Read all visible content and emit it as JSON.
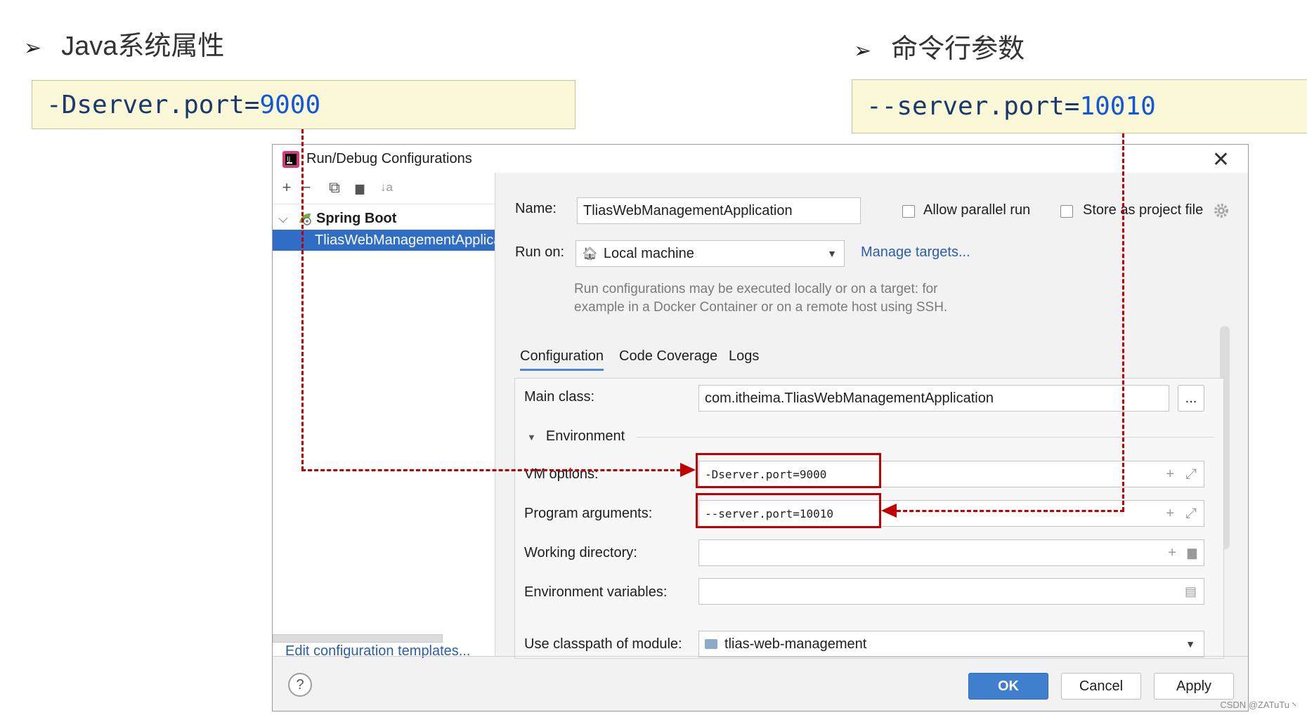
{
  "slide": {
    "left_heading": "Java系统属性",
    "right_heading": "命令行参数",
    "bullet": "➢",
    "left_code_prefix": "-Dserver.port=",
    "left_code_value": "9000",
    "right_code_prefix": "--server.port=",
    "right_code_value": "10010",
    "watermark": "CSDN @ZATuTu丶"
  },
  "dialog": {
    "title": "Run/Debug Configurations",
    "close_symbol": "✕",
    "toolbar": {
      "add": "+",
      "remove": "−",
      "copy": "⧉",
      "folder": "▆",
      "sort": "↓a"
    },
    "tree": {
      "group_arrow": "⌵",
      "group": "Spring Boot",
      "item": "TliasWebManagementApplication"
    },
    "edit_templates": "Edit configuration templates...",
    "name_label": "Name:",
    "name_value": "TliasWebManagementApplication",
    "allow_parallel": "Allow parallel run",
    "store_project_file": "Store as project file",
    "run_on_label": "Run on:",
    "run_on_value": "Local machine",
    "manage_targets": "Manage targets...",
    "hint_line1": "Run configurations may be executed locally or on a target: for",
    "hint_line2": "example in a Docker Container or on a remote host using SSH.",
    "tabs": [
      "Configuration",
      "Code Coverage",
      "Logs"
    ],
    "main_class_label": "Main class:",
    "main_class_value": "com.itheima.TliasWebManagementApplication",
    "browse": "...",
    "environment_label": "Environment",
    "vm_options_label": "VM options:",
    "vm_options_value": "-Dserver.port=9000",
    "program_args_label": "Program arguments:",
    "program_args_value": "--server.port=10010",
    "working_dir_label": "Working directory:",
    "env_vars_label": "Environment variables:",
    "classpath_label": "Use classpath of module:",
    "classpath_value": "tlias-web-management",
    "help": "?",
    "ok": "OK",
    "cancel": "Cancel",
    "apply": "Apply"
  },
  "colors": {
    "accent": "#3f7fce",
    "selection": "#2f6dc6",
    "annotation": "#c00000",
    "code_bg": "#fbf8d8"
  }
}
